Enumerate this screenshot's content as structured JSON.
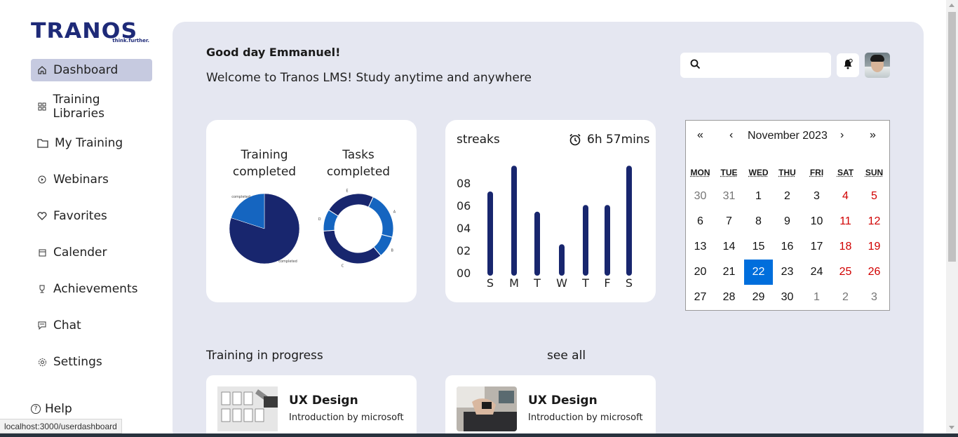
{
  "brand": {
    "name": "TRANOS",
    "tagline": "think.further."
  },
  "sidebar": {
    "items": [
      {
        "label": "Dashboard",
        "icon": "home-icon"
      },
      {
        "label": "Training Libraries",
        "icon": "grid-icon"
      },
      {
        "label": "My Training",
        "icon": "folder-icon"
      },
      {
        "label": "Webinars",
        "icon": "play-circle-icon"
      },
      {
        "label": "Favorites",
        "icon": "heart-icon"
      },
      {
        "label": "Calender",
        "icon": "calendar-icon"
      },
      {
        "label": "Achievements",
        "icon": "trophy-icon"
      },
      {
        "label": "Chat",
        "icon": "chat-icon"
      },
      {
        "label": "Settings",
        "icon": "gear-icon"
      }
    ],
    "help_label": "Help"
  },
  "header": {
    "greeting": "Good day Emmanuel!",
    "welcome": "Welcome to Tranos LMS! Study anytime and anywhere",
    "search_placeholder": ""
  },
  "stats": {
    "training_title_1": "Training",
    "training_title_2": "completed",
    "tasks_title_1": "Tasks",
    "tasks_title_2": "completed",
    "pie_labels": {
      "a": "completed",
      "b": "completed"
    },
    "donut_labels": {
      "a": "A",
      "b": "B",
      "c": "C",
      "d": "D",
      "e": "E"
    }
  },
  "streaks": {
    "title": "streaks",
    "time": "6h 57mins",
    "y_ticks": [
      "08",
      "06",
      "04",
      "02",
      "00"
    ]
  },
  "chart_data": [
    {
      "type": "pie",
      "title": "Training completed",
      "slices": [
        {
          "label": "completed",
          "value": 80,
          "color": "#18266e"
        },
        {
          "label": "completed",
          "value": 20,
          "color": "#1565c0"
        }
      ]
    },
    {
      "type": "pie",
      "title": "Tasks completed",
      "donut": true,
      "slices": [
        {
          "label": "A",
          "value": 22,
          "color": "#1565c0"
        },
        {
          "label": "B",
          "value": 10,
          "color": "#1565c0"
        },
        {
          "label": "C",
          "value": 35,
          "color": "#18266e"
        },
        {
          "label": "D",
          "value": 10,
          "color": "#1565c0"
        },
        {
          "label": "E",
          "value": 23,
          "color": "#18266e"
        }
      ]
    },
    {
      "type": "bar",
      "title": "streaks",
      "categories": [
        "S",
        "M",
        "T",
        "W",
        "T",
        "F",
        "S"
      ],
      "values": [
        7,
        9.3,
        5.2,
        2.3,
        5.8,
        5.8,
        9.3
      ],
      "ylim": [
        0,
        9
      ],
      "color": "#18266e"
    }
  ],
  "calendar": {
    "nav": {
      "prev2": "«",
      "prev": "‹",
      "next": "›",
      "next2": "»"
    },
    "month": "November 2023",
    "weekdays": [
      "MON",
      "TUE",
      "WED",
      "THU",
      "FRI",
      "SAT",
      "SUN"
    ],
    "weeks": [
      [
        "30",
        "31",
        "1",
        "2",
        "3",
        "4",
        "5"
      ],
      [
        "6",
        "7",
        "8",
        "9",
        "10",
        "11",
        "12"
      ],
      [
        "13",
        "14",
        "15",
        "16",
        "17",
        "18",
        "19"
      ],
      [
        "20",
        "21",
        "22",
        "23",
        "24",
        "25",
        "26"
      ],
      [
        "27",
        "28",
        "29",
        "30",
        "1",
        "2",
        "3"
      ]
    ],
    "today": "22"
  },
  "progress": {
    "title": "Training in progress",
    "see_all": "see all",
    "courses": [
      {
        "name": "UX Design",
        "subtitle": "Introduction by microsoft"
      },
      {
        "name": "UX Design",
        "subtitle": "Introduction by microsoft"
      }
    ]
  },
  "status_url": "localhost:3000/userdashboard"
}
